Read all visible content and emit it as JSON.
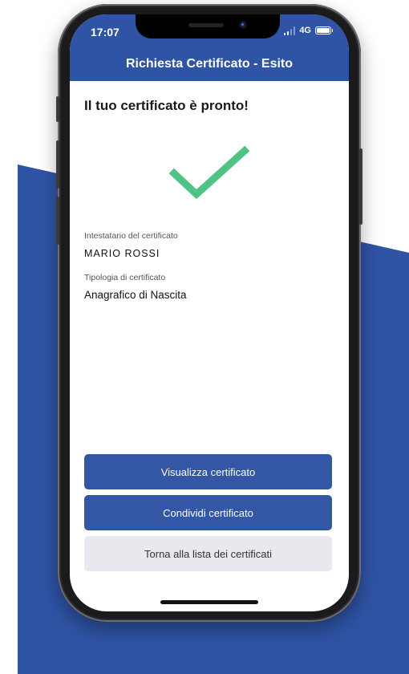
{
  "status_bar": {
    "time": "17:07",
    "network": "4G"
  },
  "app_bar": {
    "title": "Richiesta Certificato - Esito"
  },
  "main": {
    "heading": "Il tuo certificato è pronto!",
    "success_icon": "checkmark-icon",
    "fields": [
      {
        "label": "Intestatario del certificato",
        "value": "MARIO ROSSI"
      },
      {
        "label": "Tipologia di certificato",
        "value": "Anagrafico di Nascita"
      }
    ]
  },
  "actions": {
    "view_label": "Visualizza certificato",
    "share_label": "Condividi certificato",
    "back_label": "Torna alla lista dei certificati"
  },
  "colors": {
    "brand_blue": "#2f54a5",
    "success_green": "#4fc284",
    "secondary_button": "#e8e9ee"
  }
}
